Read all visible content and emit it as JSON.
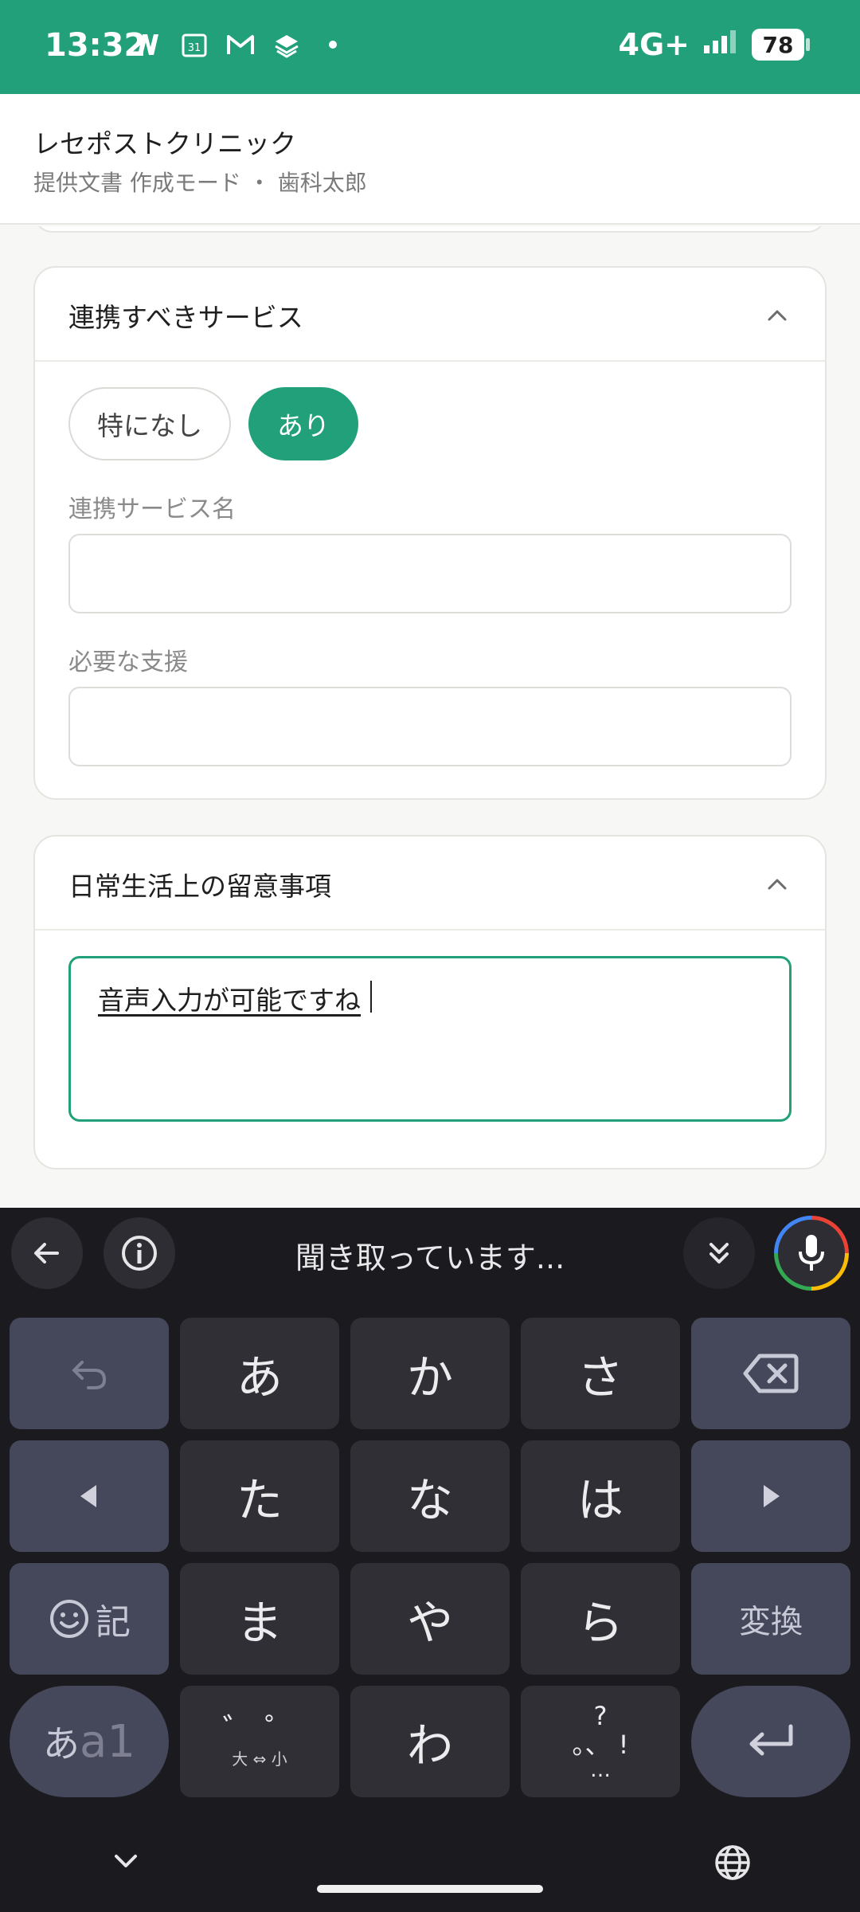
{
  "status_bar": {
    "time": "13:32",
    "calendar_day": "31",
    "network": "4G+",
    "battery": "78",
    "icons_left": [
      "netflix-n-icon",
      "calendar-icon",
      "gmail-icon",
      "stack-app-icon",
      "dot-icon"
    ],
    "bg_color": "#21a07a"
  },
  "header": {
    "title": "レセポストクリニック",
    "subtitle": "提供文書 作成モード ・ 歯科太郎"
  },
  "card_services": {
    "title": "連携すべきサービス",
    "chip_none": "特になし",
    "chip_yes": "あり",
    "field1_label": "連携サービス名",
    "field1_value": "",
    "field2_label": "必要な支援",
    "field2_value": ""
  },
  "card_daily": {
    "title": "日常生活上の留意事項",
    "text_value": "音声入力が可能ですね"
  },
  "keyboard": {
    "status": "聞き取っています...",
    "row1": [
      "あ",
      "か",
      "さ"
    ],
    "row2": [
      "た",
      "な",
      "は"
    ],
    "row3": [
      "ま",
      "や",
      "ら"
    ],
    "row3_left": "記",
    "row3_right": "変換",
    "row4_mid": "わ",
    "mode_label_a": "あ",
    "mode_label_b": "a1",
    "dakuten_top": "゛ ゜",
    "dakuten_bottom": "大 ⇔ 小",
    "punct_top": "?",
    "punct_bottom": "。、 !",
    "punct_dots": "…"
  },
  "accent_color": "#21a07a"
}
